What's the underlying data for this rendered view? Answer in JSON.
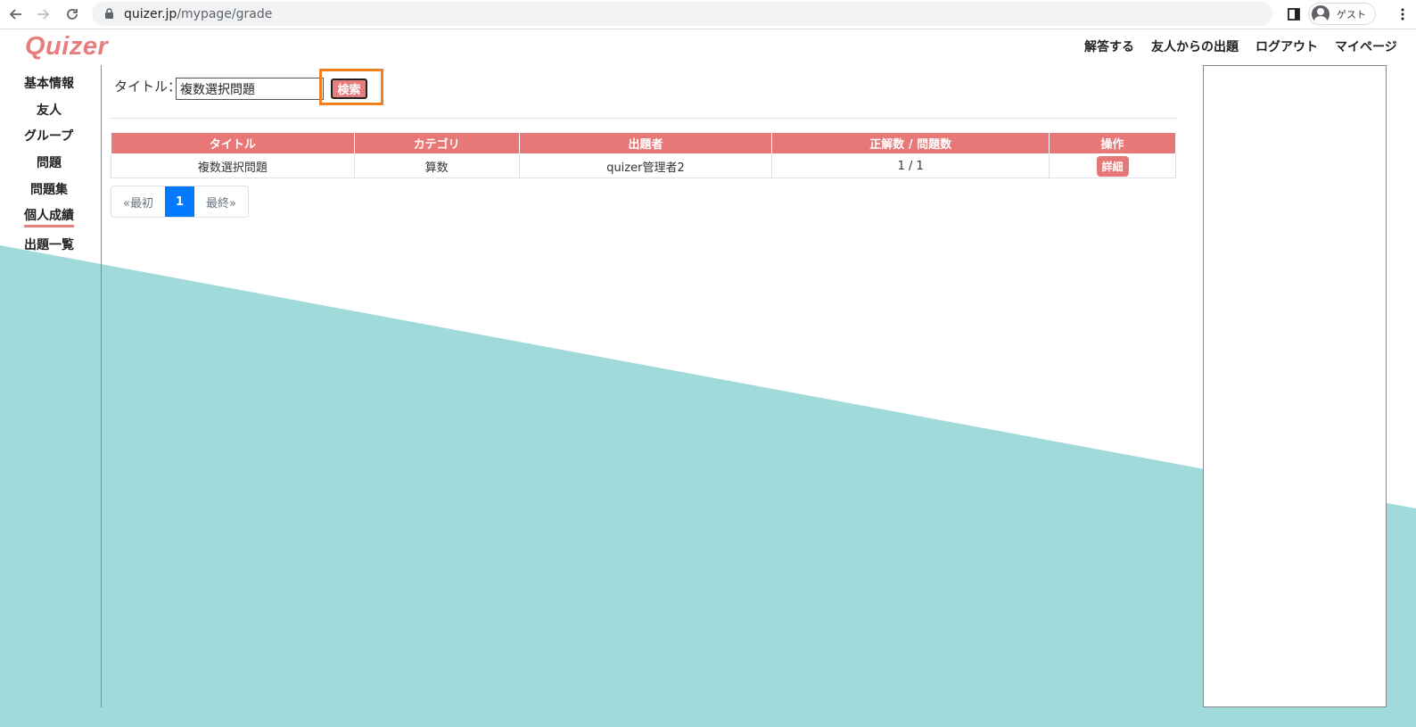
{
  "browser": {
    "url_host": "quizer.jp",
    "url_path": "/mypage/grade",
    "profile_label": "ゲスト"
  },
  "header": {
    "logo": "Quizer",
    "nav": [
      "解答する",
      "友人からの出題",
      "ログアウト",
      "マイページ"
    ]
  },
  "sidebar": {
    "items": [
      "基本情報",
      "友人",
      "グループ",
      "問題",
      "問題集",
      "個人成績",
      "出題一覧"
    ],
    "active_index": 5
  },
  "search": {
    "label": "タイトル：",
    "value": "複数選択問題",
    "button_label": "検索"
  },
  "table": {
    "headers": [
      "タイトル",
      "カテゴリ",
      "出題者",
      "正解数 / 問題数",
      "操作"
    ],
    "rows": [
      {
        "title": "複数選択問題",
        "category": "算数",
        "author": "quizer管理者2",
        "score": "1 / 1",
        "action": "詳細"
      }
    ]
  },
  "pagination": {
    "first": "«最初",
    "current": "1",
    "last": "最終»"
  },
  "colors": {
    "accent": "#e87878",
    "teal": "#a0dadb",
    "highlight": "#f47f20",
    "page_active": "#007bff"
  }
}
